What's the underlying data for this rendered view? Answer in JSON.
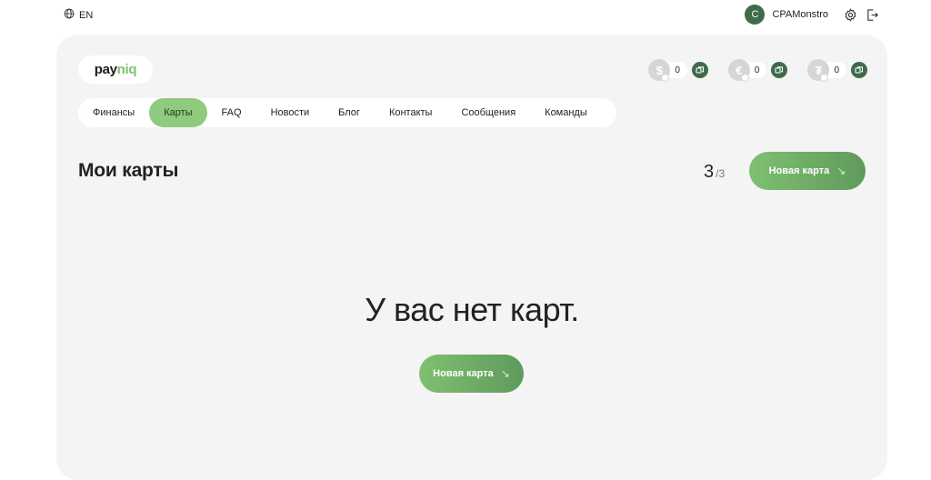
{
  "header": {
    "language": "EN",
    "user": {
      "initial": "C",
      "name": "CPAMonstro"
    },
    "icons": [
      "globe-icon",
      "settings-icon",
      "logout-icon"
    ]
  },
  "logo": {
    "text_main": "pay",
    "text_accent": "niq"
  },
  "balances": [
    {
      "currency_symbol": "$",
      "amount": "0"
    },
    {
      "currency_symbol": "€",
      "amount": "0"
    },
    {
      "currency_symbol": "₮",
      "amount": "0"
    }
  ],
  "nav": {
    "items": [
      {
        "label": "Финансы"
      },
      {
        "label": "Карты",
        "active": true
      },
      {
        "label": "FAQ"
      },
      {
        "label": "Новости"
      },
      {
        "label": "Блог"
      },
      {
        "label": "Контакты"
      },
      {
        "label": "Сообщения"
      },
      {
        "label": "Команды"
      }
    ]
  },
  "page": {
    "title": "Мои карты",
    "card_count": "3",
    "card_max": "/3",
    "new_card_label": "Новая карта",
    "new_card_arrow": "↘",
    "empty_message": "У вас нет карт."
  },
  "colors": {
    "accent_green": "#8fcb7e",
    "dark_green": "#3f6b4c",
    "panel_bg": "#f4f4f4"
  }
}
